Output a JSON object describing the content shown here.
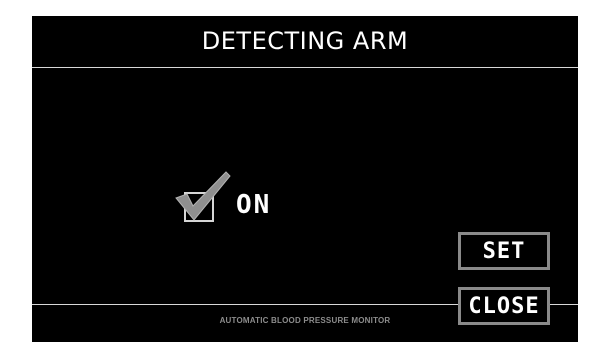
{
  "screen": {
    "title": "DETECTING ARM",
    "footer_text": "AUTOMATIC BLOOD PRESSURE MONITOR"
  },
  "option": {
    "checked": true,
    "label": "ON",
    "icon": "checkmark-icon"
  },
  "buttons": {
    "set_label": "SET",
    "close_label": "CLOSE"
  },
  "colors": {
    "background": "#000000",
    "text": "#ffffff",
    "divider": "#d8d8d8",
    "button_border": "#8a8a8a",
    "checkmark": "#8f8f8f",
    "footer_text": "#8c8c8c"
  }
}
